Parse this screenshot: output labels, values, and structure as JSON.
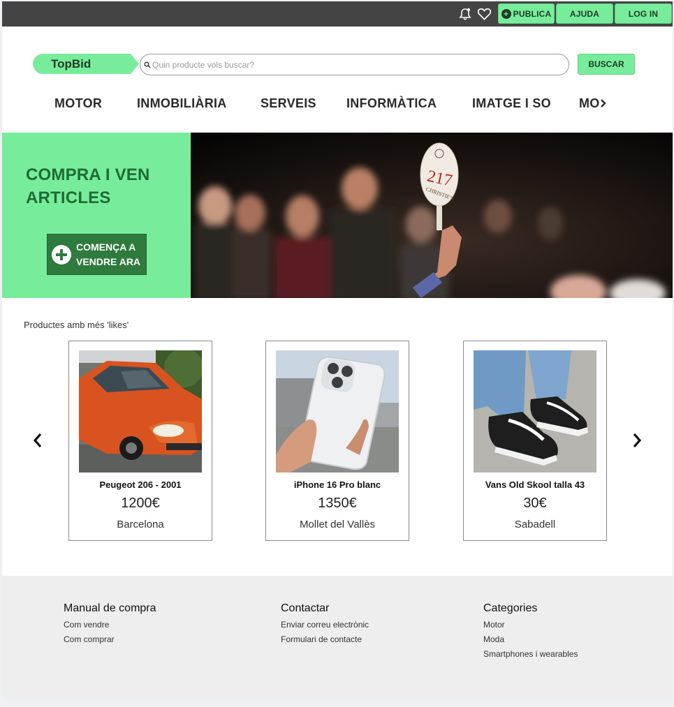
{
  "topbar": {
    "publica_label": "PUBLICA",
    "ajuda_label": "AJUDA",
    "login_label": "LOG IN",
    "accent_color": "#77ed9b",
    "bar_color": "#444444"
  },
  "header": {
    "logo_text": "TopBid",
    "search_placeholder": "Quin producte vols buscar?",
    "search_button": "BUSCAR"
  },
  "nav": {
    "items": [
      "MOTOR",
      "INMOBILIÀRIA",
      "SERVEIS",
      "INFORMÀTICA",
      "IMATGE I SO",
      "MO"
    ]
  },
  "hero": {
    "title": "COMPRA I VEN ARTICLES",
    "cta_label": "COMENÇA A VENDRE ARA",
    "paddle_number": "217",
    "paddle_brand": "CHRISTIE'S"
  },
  "products": {
    "section_title": "Productes amb més 'likes'",
    "items": [
      {
        "title": "Peugeot 206 - 2001",
        "price": "1200€",
        "city": "Barcelona"
      },
      {
        "title": "iPhone 16 Pro blanc",
        "price": "1350€",
        "city": "Mollet del Vallès"
      },
      {
        "title": "Vans Old Skool talla 43",
        "price": "30€",
        "city": "Sabadell"
      }
    ]
  },
  "footer": {
    "columns": [
      {
        "heading": "Manual de compra",
        "links": [
          "Com vendre",
          "Com comprar"
        ]
      },
      {
        "heading": "Contactar",
        "links": [
          "Enviar correu electrònic",
          "Formulari de contacte"
        ]
      },
      {
        "heading": "Categories",
        "links": [
          "Motor",
          "Moda",
          "Smartphones i wearables"
        ]
      }
    ]
  }
}
